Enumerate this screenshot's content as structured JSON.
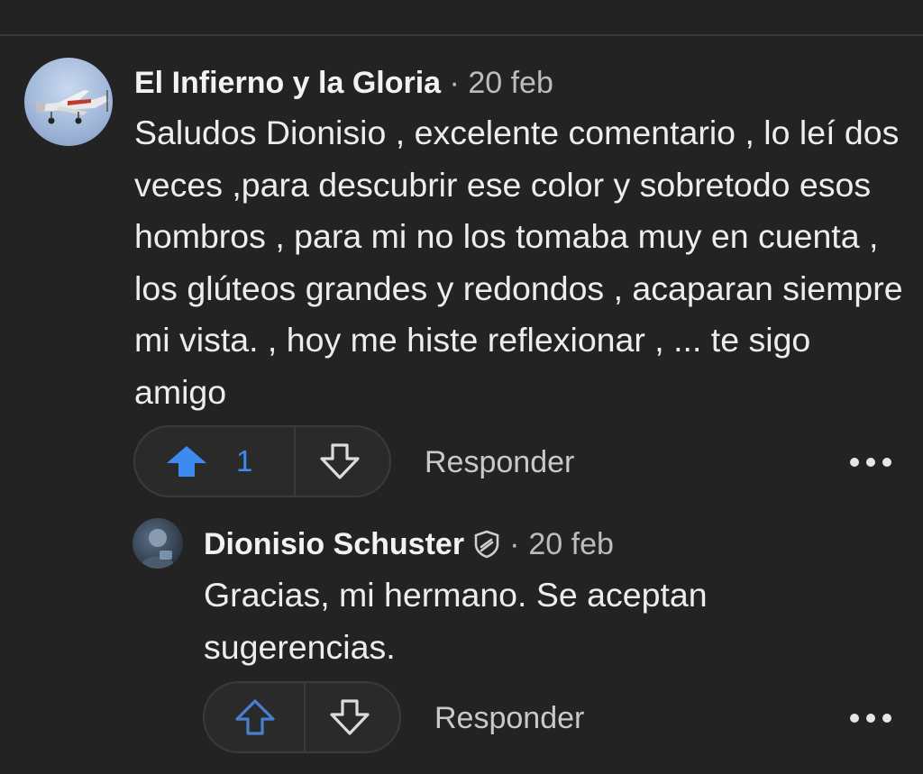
{
  "comments": [
    {
      "author": "El Infierno y la Gloria",
      "separator": "·",
      "date": "20 feb",
      "body": "Saludos Dionisio , excelente comentario , lo leí dos veces ,para descubrir ese color y sobretodo esos hombros , para mi no los tomaba muy en cuenta , los glúteos grandes y redondos , acaparan siempre mi vista. , hoy me histe reflexionar , ... te sigo amigo",
      "upvotes": "1",
      "upvoted": true,
      "reply_label": "Responder",
      "avatar_icon": "airplane-avatar",
      "more_icon": "more-dots-icon"
    },
    {
      "author": "Dionisio Schuster",
      "author_badge_icon": "shield-badge-icon",
      "separator": "·",
      "date": "20 feb",
      "body": "Gracias, mi hermano. Se aceptan sugerencias.",
      "upvotes": "",
      "upvoted": false,
      "reply_label": "Responder",
      "avatar_icon": "person-avatar",
      "more_icon": "more-dots-icon"
    }
  ],
  "colors": {
    "background": "#232323",
    "upvote_active": "#3d8bf0",
    "upvote_idle": "#4a7fd0",
    "text": "#ededed",
    "muted": "#bdbdbd"
  }
}
